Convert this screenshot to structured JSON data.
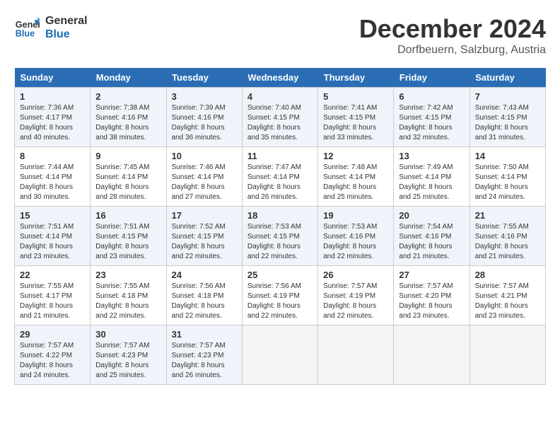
{
  "header": {
    "logo_line1": "General",
    "logo_line2": "Blue",
    "month": "December 2024",
    "location": "Dorfbeuern, Salzburg, Austria"
  },
  "weekdays": [
    "Sunday",
    "Monday",
    "Tuesday",
    "Wednesday",
    "Thursday",
    "Friday",
    "Saturday"
  ],
  "weeks": [
    [
      {
        "day": "1",
        "sunrise": "Sunrise: 7:36 AM",
        "sunset": "Sunset: 4:17 PM",
        "daylight": "Daylight: 8 hours and 40 minutes."
      },
      {
        "day": "2",
        "sunrise": "Sunrise: 7:38 AM",
        "sunset": "Sunset: 4:16 PM",
        "daylight": "Daylight: 8 hours and 38 minutes."
      },
      {
        "day": "3",
        "sunrise": "Sunrise: 7:39 AM",
        "sunset": "Sunset: 4:16 PM",
        "daylight": "Daylight: 8 hours and 36 minutes."
      },
      {
        "day": "4",
        "sunrise": "Sunrise: 7:40 AM",
        "sunset": "Sunset: 4:15 PM",
        "daylight": "Daylight: 8 hours and 35 minutes."
      },
      {
        "day": "5",
        "sunrise": "Sunrise: 7:41 AM",
        "sunset": "Sunset: 4:15 PM",
        "daylight": "Daylight: 8 hours and 33 minutes."
      },
      {
        "day": "6",
        "sunrise": "Sunrise: 7:42 AM",
        "sunset": "Sunset: 4:15 PM",
        "daylight": "Daylight: 8 hours and 32 minutes."
      },
      {
        "day": "7",
        "sunrise": "Sunrise: 7:43 AM",
        "sunset": "Sunset: 4:15 PM",
        "daylight": "Daylight: 8 hours and 31 minutes."
      }
    ],
    [
      {
        "day": "8",
        "sunrise": "Sunrise: 7:44 AM",
        "sunset": "Sunset: 4:14 PM",
        "daylight": "Daylight: 8 hours and 30 minutes."
      },
      {
        "day": "9",
        "sunrise": "Sunrise: 7:45 AM",
        "sunset": "Sunset: 4:14 PM",
        "daylight": "Daylight: 8 hours and 28 minutes."
      },
      {
        "day": "10",
        "sunrise": "Sunrise: 7:46 AM",
        "sunset": "Sunset: 4:14 PM",
        "daylight": "Daylight: 8 hours and 27 minutes."
      },
      {
        "day": "11",
        "sunrise": "Sunrise: 7:47 AM",
        "sunset": "Sunset: 4:14 PM",
        "daylight": "Daylight: 8 hours and 26 minutes."
      },
      {
        "day": "12",
        "sunrise": "Sunrise: 7:48 AM",
        "sunset": "Sunset: 4:14 PM",
        "daylight": "Daylight: 8 hours and 25 minutes."
      },
      {
        "day": "13",
        "sunrise": "Sunrise: 7:49 AM",
        "sunset": "Sunset: 4:14 PM",
        "daylight": "Daylight: 8 hours and 25 minutes."
      },
      {
        "day": "14",
        "sunrise": "Sunrise: 7:50 AM",
        "sunset": "Sunset: 4:14 PM",
        "daylight": "Daylight: 8 hours and 24 minutes."
      }
    ],
    [
      {
        "day": "15",
        "sunrise": "Sunrise: 7:51 AM",
        "sunset": "Sunset: 4:14 PM",
        "daylight": "Daylight: 8 hours and 23 minutes."
      },
      {
        "day": "16",
        "sunrise": "Sunrise: 7:51 AM",
        "sunset": "Sunset: 4:15 PM",
        "daylight": "Daylight: 8 hours and 23 minutes."
      },
      {
        "day": "17",
        "sunrise": "Sunrise: 7:52 AM",
        "sunset": "Sunset: 4:15 PM",
        "daylight": "Daylight: 8 hours and 22 minutes."
      },
      {
        "day": "18",
        "sunrise": "Sunrise: 7:53 AM",
        "sunset": "Sunset: 4:15 PM",
        "daylight": "Daylight: 8 hours and 22 minutes."
      },
      {
        "day": "19",
        "sunrise": "Sunrise: 7:53 AM",
        "sunset": "Sunset: 4:16 PM",
        "daylight": "Daylight: 8 hours and 22 minutes."
      },
      {
        "day": "20",
        "sunrise": "Sunrise: 7:54 AM",
        "sunset": "Sunset: 4:16 PM",
        "daylight": "Daylight: 8 hours and 21 minutes."
      },
      {
        "day": "21",
        "sunrise": "Sunrise: 7:55 AM",
        "sunset": "Sunset: 4:16 PM",
        "daylight": "Daylight: 8 hours and 21 minutes."
      }
    ],
    [
      {
        "day": "22",
        "sunrise": "Sunrise: 7:55 AM",
        "sunset": "Sunset: 4:17 PM",
        "daylight": "Daylight: 8 hours and 21 minutes."
      },
      {
        "day": "23",
        "sunrise": "Sunrise: 7:55 AM",
        "sunset": "Sunset: 4:18 PM",
        "daylight": "Daylight: 8 hours and 22 minutes."
      },
      {
        "day": "24",
        "sunrise": "Sunrise: 7:56 AM",
        "sunset": "Sunset: 4:18 PM",
        "daylight": "Daylight: 8 hours and 22 minutes."
      },
      {
        "day": "25",
        "sunrise": "Sunrise: 7:56 AM",
        "sunset": "Sunset: 4:19 PM",
        "daylight": "Daylight: 8 hours and 22 minutes."
      },
      {
        "day": "26",
        "sunrise": "Sunrise: 7:57 AM",
        "sunset": "Sunset: 4:19 PM",
        "daylight": "Daylight: 8 hours and 22 minutes."
      },
      {
        "day": "27",
        "sunrise": "Sunrise: 7:57 AM",
        "sunset": "Sunset: 4:20 PM",
        "daylight": "Daylight: 8 hours and 23 minutes."
      },
      {
        "day": "28",
        "sunrise": "Sunrise: 7:57 AM",
        "sunset": "Sunset: 4:21 PM",
        "daylight": "Daylight: 8 hours and 23 minutes."
      }
    ],
    [
      {
        "day": "29",
        "sunrise": "Sunrise: 7:57 AM",
        "sunset": "Sunset: 4:22 PM",
        "daylight": "Daylight: 8 hours and 24 minutes."
      },
      {
        "day": "30",
        "sunrise": "Sunrise: 7:57 AM",
        "sunset": "Sunset: 4:23 PM",
        "daylight": "Daylight: 8 hours and 25 minutes."
      },
      {
        "day": "31",
        "sunrise": "Sunrise: 7:57 AM",
        "sunset": "Sunset: 4:23 PM",
        "daylight": "Daylight: 8 hours and 26 minutes."
      },
      null,
      null,
      null,
      null
    ]
  ]
}
